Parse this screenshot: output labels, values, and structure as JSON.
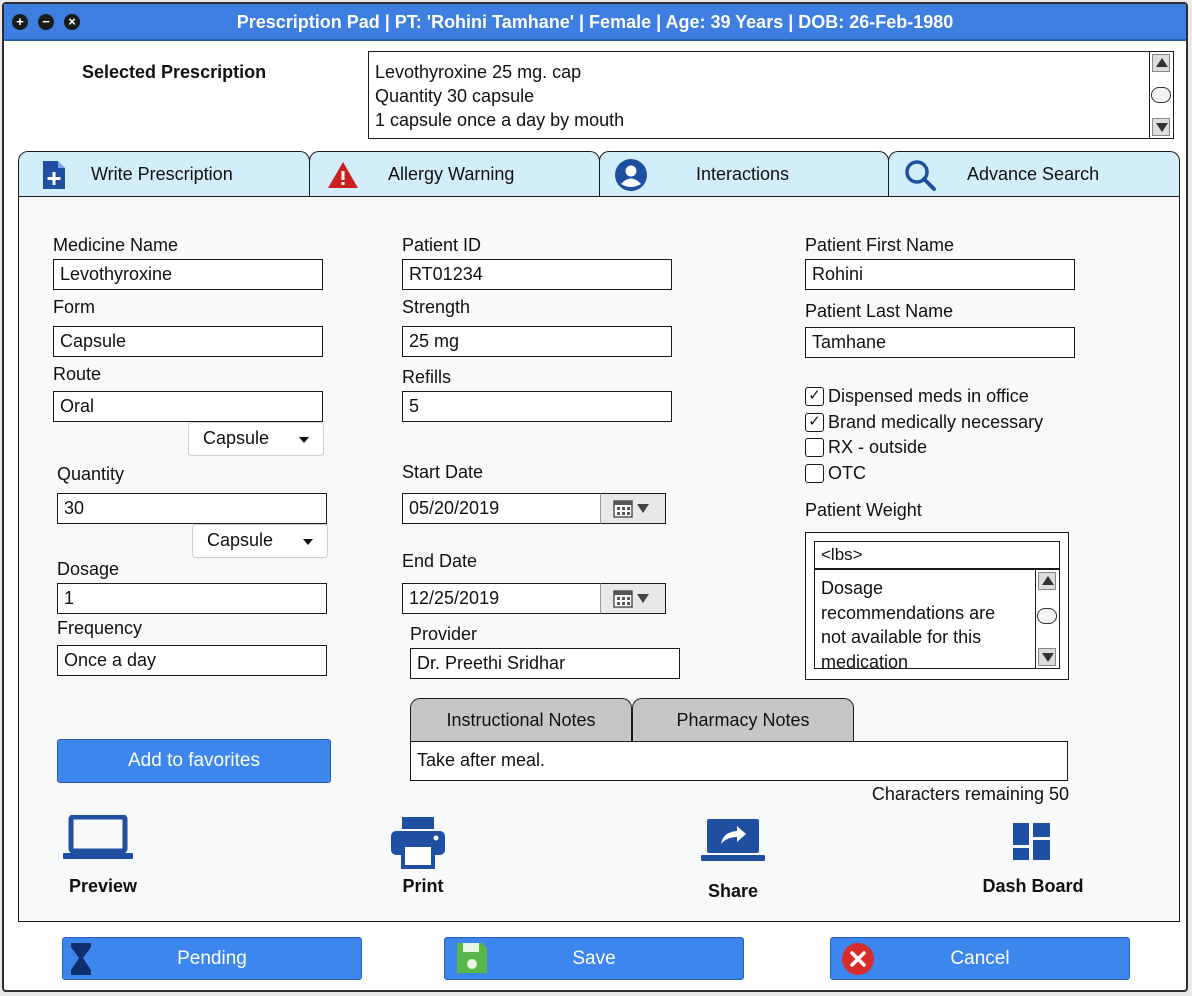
{
  "window": {
    "title": "Prescription Pad | PT: 'Rohini Tamhane' | Female | Age: 39 Years | DOB: 26-Feb-1980",
    "controls": [
      "+",
      "−",
      "×"
    ]
  },
  "selected_prescription": {
    "label": "Selected Prescription",
    "lines": [
      "Levothyroxine 25 mg. cap",
      "Quantity 30 capsule",
      "1 capsule once a day by mouth"
    ]
  },
  "tabs": [
    {
      "label": "Write Prescription",
      "icon": "document-plus-icon"
    },
    {
      "label": "Allergy Warning",
      "icon": "warning-icon"
    },
    {
      "label": "Interactions",
      "icon": "user-circle-icon"
    },
    {
      "label": "Advance Search",
      "icon": "search-icon"
    }
  ],
  "form": {
    "medicine_name": {
      "label": "Medicine Name",
      "value": "Levothyroxine"
    },
    "form": {
      "label": "Form",
      "value": "Capsule"
    },
    "route": {
      "label": "Route",
      "value": "Oral",
      "unit": "Capsule"
    },
    "quantity": {
      "label": "Quantity",
      "value": "30",
      "unit": "Capsule"
    },
    "dosage": {
      "label": "Dosage",
      "value": "1"
    },
    "frequency": {
      "label": "Frequency",
      "value": "Once a day"
    },
    "patient_id": {
      "label": "Patient ID",
      "value": "RT01234"
    },
    "strength": {
      "label": "Strength",
      "value": "25 mg"
    },
    "refills": {
      "label": "Refills",
      "value": "5"
    },
    "start_date": {
      "label": "Start Date",
      "value": "05/20/2019"
    },
    "end_date": {
      "label": "End Date",
      "value": "12/25/2019"
    },
    "provider": {
      "label": "Provider",
      "value": "Dr. Preethi Sridhar"
    },
    "patient_first_name": {
      "label": "Patient First Name",
      "value": "Rohini"
    },
    "patient_last_name": {
      "label": "Patient Last Name",
      "value": "Tamhane"
    }
  },
  "checkboxes": [
    {
      "label": "Dispensed meds in office",
      "checked": true,
      "mark": "✓"
    },
    {
      "label": "Brand medically necessary",
      "checked": true,
      "mark": "✓"
    },
    {
      "label": "RX - outside",
      "checked": false,
      "mark": ""
    },
    {
      "label": "OTC",
      "checked": false,
      "mark": ""
    }
  ],
  "patient_weight": {
    "label": "Patient Weight",
    "placeholder": "<lbs>",
    "note_lines": [
      "Dosage",
      "recommendations are",
      "not available for this",
      "medication"
    ]
  },
  "notes": {
    "tabs": [
      "Instructional Notes",
      "Pharmacy Notes"
    ],
    "value": "Take after meal.",
    "chars_remaining": "Characters remaining 50"
  },
  "favorites_button": "Add to favorites",
  "actions": [
    {
      "label": "Preview",
      "icon": "laptop-icon"
    },
    {
      "label": "Print",
      "icon": "printer-icon"
    },
    {
      "label": "Share",
      "icon": "share-icon"
    },
    {
      "label": "Dash Board",
      "icon": "dashboard-icon"
    }
  ],
  "bottom_buttons": [
    {
      "label": "Pending",
      "icon": "hourglass-icon"
    },
    {
      "label": "Save",
      "icon": "save-icon"
    },
    {
      "label": "Cancel",
      "icon": "cancel-icon"
    }
  ],
  "colors": {
    "accent": "#3d86ee",
    "titlebar": "#3d7ee0",
    "tab_bg": "#d3eefb",
    "icon_blue": "#1f4fa0",
    "warning_red": "#cc2020"
  }
}
